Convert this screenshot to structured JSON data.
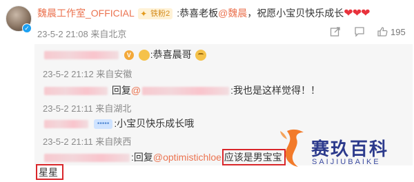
{
  "post": {
    "username": "魏晨工作室_OFFICIAL",
    "badge": "铁粉2",
    "text_prefix": ":恭喜老板",
    "mention": "@魏晨",
    "text_suffix": "，祝愿小宝贝快乐成长",
    "hearts": "❤❤❤",
    "meta": "23-5-2 21:08 来自北京",
    "like_count": "195"
  },
  "replies": [
    {
      "text": ":恭喜晨哥",
      "meta": "23-5-2 21:12 来自安徽"
    },
    {
      "reply_word": "回复",
      "mention_prefix": "@",
      "text": ":我也是这样觉得！！",
      "meta": "23-5-2 21:11 来自湖北"
    },
    {
      "badge": "•••••",
      "text": ":小宝贝快乐成长哦",
      "meta": "23-5-2 21:11 来自陕西"
    },
    {
      "reply_word": ":回复",
      "mention": "@optimistichloe",
      "text": ":应该是男宝宝"
    }
  ],
  "highlight_tail": "星星",
  "watermark": {
    "cn": "赛玖百科",
    "en": "SAIJIUBAIKE"
  },
  "colors": {
    "link": "#eb7350",
    "highlight_box": "#d9262a",
    "watermark_blue": "#2c3a8c",
    "watermark_orange": "#f27a2a"
  }
}
